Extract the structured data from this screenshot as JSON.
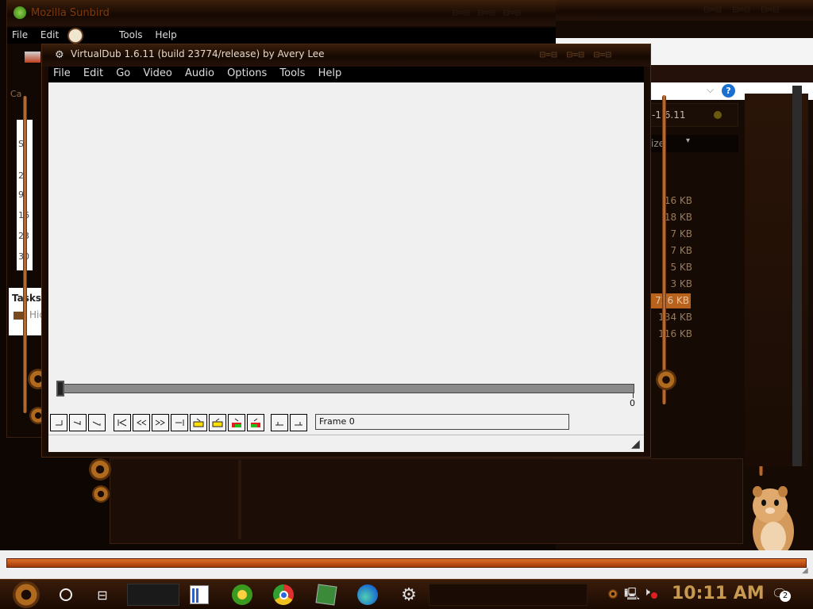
{
  "sunbird": {
    "title": "Mozilla Sunbird",
    "menu": [
      "File",
      "Edit",
      "Tools",
      "Help"
    ],
    "sidebar_items": [
      "S",
      "2",
      "9",
      "16",
      "23",
      "30"
    ],
    "tasks_label": "Tasks",
    "tasks_item": "Hid",
    "tab_label": "Ca"
  },
  "explorer": {
    "path_fragment": "-1.6.11",
    "size_header": "ize",
    "sizes": [
      "16 KB",
      "18 KB",
      "7 KB",
      "7 KB",
      "5 KB",
      "3 KB",
      "726 KB",
      "134 KB",
      "116 KB"
    ],
    "selected_index": 6,
    "help_glyph": "?"
  },
  "virtualdub": {
    "title": "VirtualDub 1.6.11 (build 23774/release) by Avery Lee",
    "menu": [
      "File",
      "Edit",
      "Go",
      "Video",
      "Audio",
      "Options",
      "Tools",
      "Help"
    ],
    "end_frame": "0",
    "frame_label": "Frame 0"
  },
  "taskbar": {
    "clock": "10:11 AM",
    "notification_count": "2"
  },
  "colors": {
    "chrome": "#1a0c04",
    "copper": "#b06a1e",
    "highlight": "#b8621c",
    "client": "#f0f0f0"
  }
}
